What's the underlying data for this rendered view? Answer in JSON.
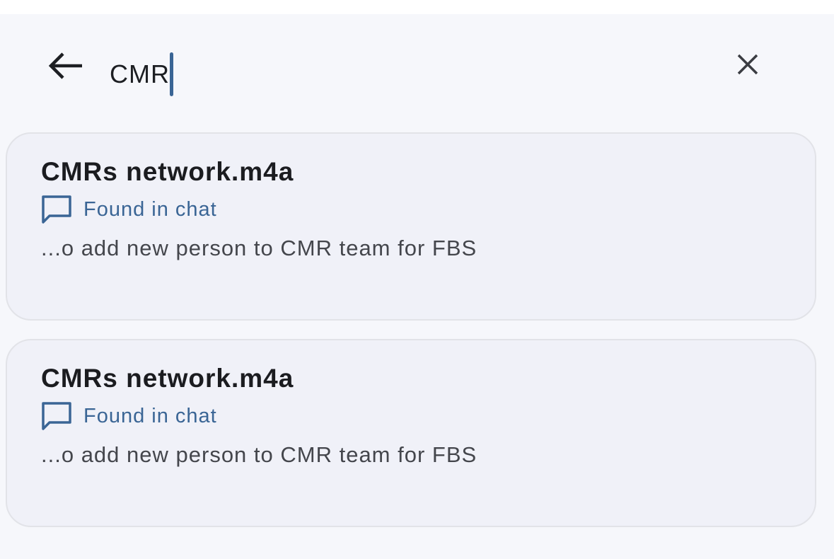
{
  "search": {
    "query": "CMR"
  },
  "results": [
    {
      "title": "CMRs network.m4a",
      "source": "Found in chat",
      "snippet": "...o add new person to CMR team for FBS"
    },
    {
      "title": "CMRs network.m4a",
      "source": "Found in chat",
      "snippet": "...o add new person to CMR team for FBS"
    }
  ]
}
